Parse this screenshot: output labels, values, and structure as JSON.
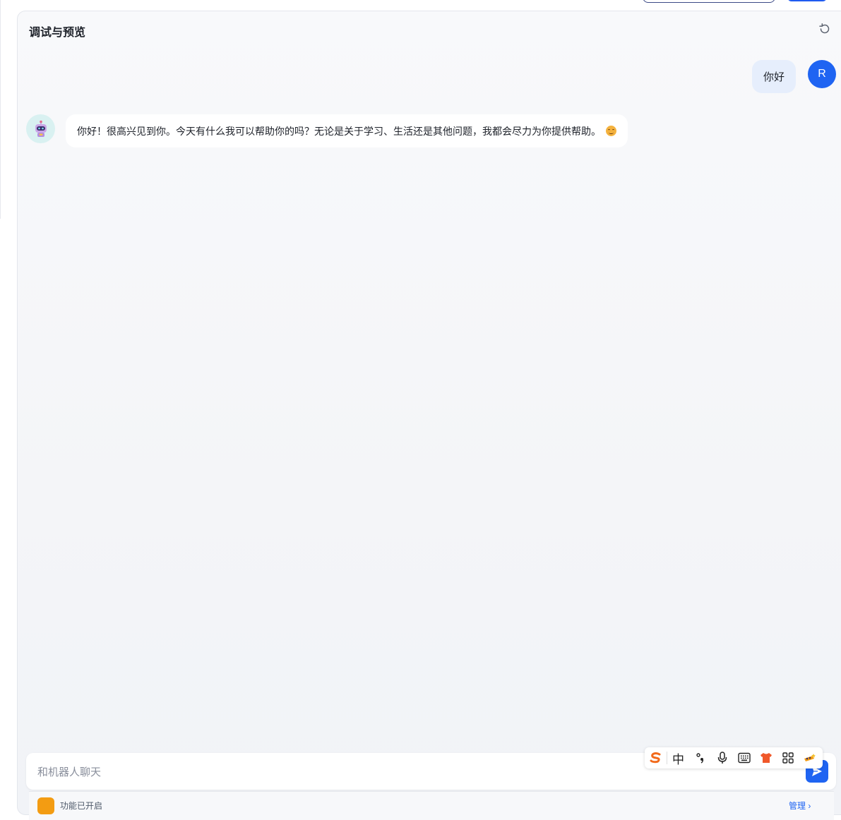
{
  "panel": {
    "title": "调试与预览",
    "reset_icon": "refresh-icon"
  },
  "messages": [
    {
      "role": "user",
      "avatar_letter": "R",
      "text": "你好",
      "avatar_color": "#1f64f2",
      "bubble_color": "#e6eefc"
    },
    {
      "role": "bot",
      "avatar_icon": "robot-icon",
      "text": "你好！很高兴见到你。今天有什么我可以帮助你的吗？无论是关于学习、生活还是其他问题，我都会尽力为你提供帮助。",
      "emoji": "smile-emoji"
    }
  ],
  "composer": {
    "placeholder": "和机器人聊天",
    "value": "",
    "send_icon": "send-icon"
  },
  "ime_toolbar": {
    "mode_label": "中",
    "items": [
      "sogou-logo-icon",
      "chinese-mode",
      "punctuation-icon",
      "microphone-icon",
      "keyboard-icon",
      "skin-icon",
      "grid-icon",
      "more-icon"
    ]
  },
  "bottom_bar": {
    "plugin_label": "功能已开启",
    "manage_label": "管理 ›"
  },
  "colors": {
    "accent": "#1f64f2",
    "panel_bg": "#f6f7f9"
  }
}
